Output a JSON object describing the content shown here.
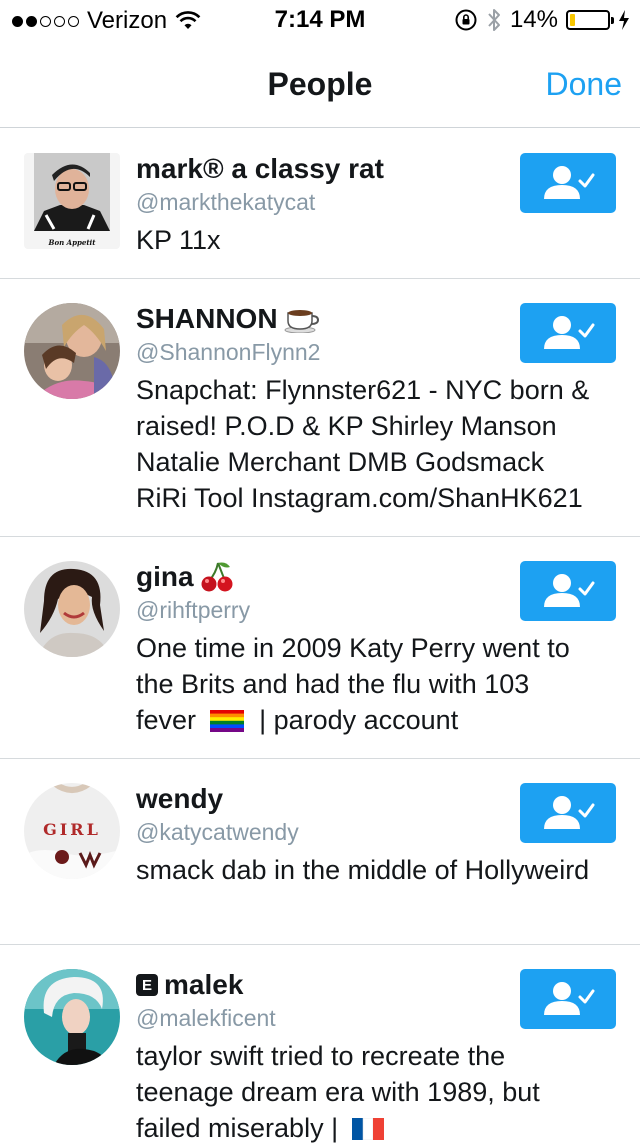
{
  "status_bar": {
    "carrier": "Verizon",
    "time": "7:14 PM",
    "battery_percent": "14%",
    "battery_level": 0.14,
    "signal_dots": [
      true,
      true,
      false,
      false,
      false
    ]
  },
  "nav": {
    "title": "People",
    "done_label": "Done"
  },
  "people": [
    {
      "name": "mark® a classy rat",
      "handle": "@markthekatycat",
      "bio": "KP 11x",
      "avatar_caption": "Bon Appetit",
      "name_icon": null
    },
    {
      "name": "SHANNON",
      "handle": "@ShannonFlynn2",
      "bio": "Snapchat: Flynnster621 - NYC born & raised! P.O.D & KP Shirley Manson Natalie Merchant DMB Godsmack RiRi Tool Instagram.com/ShanHK621",
      "name_icon": "coffee-icon"
    },
    {
      "name": "gina",
      "handle": "@rihftperry",
      "bio_before_icon": "One time in 2009 Katy Perry went to the Brits and had the flu with 103 fever",
      "bio_after_icon": "| parody account",
      "name_icon": "cherries-icon"
    },
    {
      "name": "wendy",
      "handle": "@katycatwendy",
      "bio": "smack dab in the middle of Hollyweird",
      "avatar_caption": "GIRL",
      "name_icon": null
    },
    {
      "name": "malek",
      "handle": "@malekficent",
      "bio": "taylor swift tried to recreate the teenage dream era with 1989, but failed miserably |",
      "name_icon": "explicit-badge-icon",
      "badge_letter": "E"
    }
  ],
  "colors": {
    "accent": "#1da1f2",
    "secondary_text": "#8899a6",
    "divider": "#d6dadd"
  }
}
